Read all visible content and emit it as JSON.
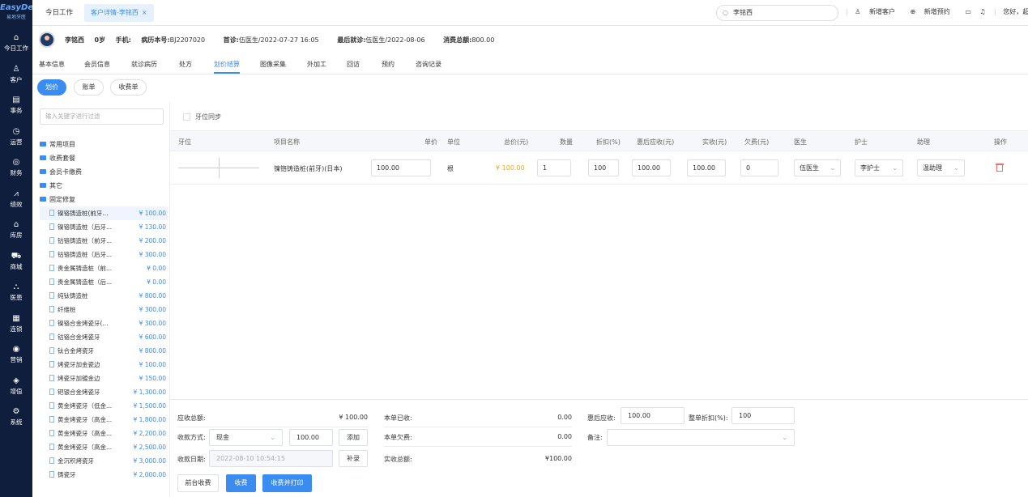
{
  "brand": {
    "name": "EasyDent",
    "sub": "易地牙医"
  },
  "nav": [
    {
      "icon": "⌂",
      "label": "今日工作"
    },
    {
      "icon": "♙",
      "label": "客户"
    },
    {
      "icon": "▤",
      "label": "事务"
    },
    {
      "icon": "◷",
      "label": "运营"
    },
    {
      "icon": "◎",
      "label": "财务"
    },
    {
      "icon": "⩘",
      "label": "绩效"
    },
    {
      "icon": "⌂",
      "label": "库房"
    },
    {
      "icon": "⛟",
      "label": "商城"
    },
    {
      "icon": "⛬",
      "label": "医患"
    },
    {
      "icon": "▦",
      "label": "连锁"
    },
    {
      "icon": "◉",
      "label": "营销"
    },
    {
      "icon": "◈",
      "label": "增值"
    },
    {
      "icon": "⚙",
      "label": "系统"
    }
  ],
  "topbar": {
    "home_tab": "今日工作",
    "active_tab": "客户详情-李铭西",
    "close": "×",
    "search_value": "李铭西",
    "new_customer": "新增客户",
    "new_appointment": "新增预约",
    "greeting": "您好，超管"
  },
  "patient": {
    "name": "李铭西",
    "age": "0岁",
    "phone_label": "手机:",
    "record_label": "病历本号:",
    "record_no": "BJ2207020",
    "first_visit_label": "首诊:",
    "first_visit": "伍医生/2022-07-27 16:05",
    "last_visit_label": "最后就诊:",
    "last_visit": "伍医生/2022-08-06",
    "total_label": "消费总额:",
    "total": "800.00"
  },
  "subtabs": [
    "基本信息",
    "会员信息",
    "就诊病历",
    "处方",
    "划价结算",
    "图像采集",
    "外加工",
    "回访",
    "预约",
    "咨询记录"
  ],
  "modes": [
    "划价",
    "账单",
    "收费单"
  ],
  "left": {
    "filter_placeholder": "输入关键字进行过滤",
    "folders": [
      "常用项目",
      "收费套餐",
      "会员卡缴费",
      "其它",
      "固定修复"
    ],
    "items": [
      {
        "name": "镍铬铸造桩(前牙...",
        "price": "¥ 100.00"
      },
      {
        "name": "镍铬铸造桩（后牙...",
        "price": "¥ 130.00"
      },
      {
        "name": "钴铬铸造桩（前牙...",
        "price": "¥ 200.00"
      },
      {
        "name": "钴铬铸造桩（后牙...",
        "price": "¥ 300.00"
      },
      {
        "name": "贵金属铸造桩（前...",
        "price": "¥ 0.00"
      },
      {
        "name": "贵金属铸造桩（后...",
        "price": "¥ 0.00"
      },
      {
        "name": "纯钛铸造桩",
        "price": "¥ 800.00"
      },
      {
        "name": "纤维桩",
        "price": "¥ 300.00"
      },
      {
        "name": "镍铬合金烤瓷牙(...",
        "price": "¥ 300.00"
      },
      {
        "name": "钴铬合金烤瓷牙",
        "price": "¥ 600.00"
      },
      {
        "name": "钛合金烤瓷牙",
        "price": "¥ 800.00"
      },
      {
        "name": "烤瓷牙加金瓷边",
        "price": "¥ 100.00"
      },
      {
        "name": "烤瓷牙加镀金边",
        "price": "¥ 150.00"
      },
      {
        "name": "钯银合金烤瓷牙",
        "price": "¥ 1,300.00"
      },
      {
        "name": "黄金烤瓷牙（低金...",
        "price": "¥ 1,500.00"
      },
      {
        "name": "黄金烤瓷牙（高金...",
        "price": "¥ 1,800.00"
      },
      {
        "name": "黄金烤瓷牙（高金...",
        "price": "¥ 2,200.00"
      },
      {
        "name": "黄金烤瓷牙（高金...",
        "price": "¥ 2,500.00"
      },
      {
        "name": "金沉积烤瓷牙",
        "price": "¥ 3,000.00"
      },
      {
        "name": "铸瓷牙",
        "price": "¥ 2,000.00"
      }
    ]
  },
  "table": {
    "sync_label": "牙位同步",
    "headers": [
      "牙位",
      "项目名称",
      "单价",
      "单位",
      "总价(元)",
      "数量",
      "折扣(%)",
      "惠后应收(元)",
      "实收(元)",
      "欠费(元)",
      "医生",
      "护士",
      "助理",
      "操作"
    ],
    "row": {
      "item": "镍铬铸造桩(前牙)(日本)",
      "unit_price": "100.00",
      "unit": "根",
      "total": "¥ 100.00",
      "qty": "1",
      "discount": "100",
      "after": "100.00",
      "received": "100.00",
      "owed": "0",
      "doctor": "伍医生",
      "nurse": "李护士",
      "assistant": "温助理"
    }
  },
  "payment": {
    "due_label": "应收总额:",
    "due": "¥ 100.00",
    "paid_label": "本单已收:",
    "paid": "0.00",
    "after_label": "惠后应收:",
    "after_value": "100.00",
    "whole_discount_label": "整单折扣(%):",
    "whole_discount": "100",
    "method_label": "收款方式:",
    "method": "现金",
    "method_amount": "100.00",
    "add": "添加",
    "owe_label": "本单欠费:",
    "owe": "0.00",
    "note_label": "备注:",
    "date_label": "收款日期:",
    "date": "2022-08-10 10:54:15",
    "supplement": "补录",
    "actual_label": "实收总额:",
    "actual": "¥100.00",
    "btn_front": "前台收费",
    "btn_charge": "收费",
    "btn_charge_print": "收费并打印"
  },
  "colors": {
    "primary": "#3b8cf0",
    "nav_bg": "#0f1e3d",
    "danger": "#f56c6c",
    "price": "#f5a623"
  }
}
